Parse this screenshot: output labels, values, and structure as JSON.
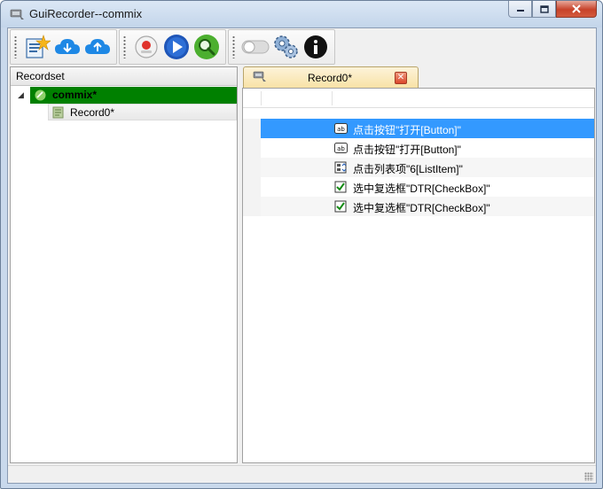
{
  "window": {
    "title": "GuiRecorder--commix",
    "app_icon": "recorder-app-icon",
    "caption": {
      "minimize_icon": "minimize-icon",
      "maximize_icon": "maximize-icon",
      "close_icon": "close-icon"
    }
  },
  "toolbar": {
    "groups": [
      [
        "new-project-icon",
        "download-cloud-icon",
        "upload-cloud-icon"
      ],
      [
        "record-icon",
        "play-icon",
        "search-icon"
      ],
      [
        "toggle-switch-icon",
        "settings-gears-icon",
        "info-icon"
      ]
    ]
  },
  "left_panel": {
    "header": "Recordset",
    "tree": {
      "root_label": "commix*",
      "children": [
        "Record0*"
      ]
    }
  },
  "editor": {
    "tab_label": "Record0*",
    "rows": [
      {
        "icon": "button-ab-icon",
        "text": "点击按钮\"打开[Button]\"",
        "selected": true
      },
      {
        "icon": "button-ab-icon",
        "text": "点击按钮\"打开[Button]\"",
        "selected": false
      },
      {
        "icon": "list-spin-icon",
        "text": "点击列表项\"6[ListItem]\"",
        "selected": false
      },
      {
        "icon": "checkbox-checked-icon",
        "text": "选中复选框\"DTR[CheckBox]\"",
        "selected": false
      },
      {
        "icon": "checkbox-checked-icon",
        "text": "选中复选框\"DTR[CheckBox]\"",
        "selected": false
      }
    ]
  },
  "colors": {
    "tree_selection": "#008000",
    "row_selection": "#3399ff",
    "tab_background": "#f8e2a6",
    "close_red": "#d9462a"
  }
}
